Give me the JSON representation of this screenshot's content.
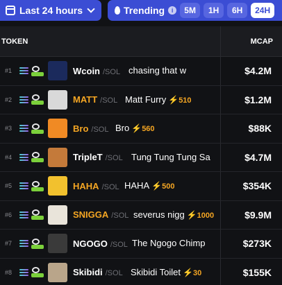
{
  "time_filter": {
    "label": "Last 24 hours"
  },
  "trending": {
    "label": "Trending",
    "info": "i",
    "timeframes": [
      "5M",
      "1H",
      "6H",
      "24H"
    ],
    "active": "24H"
  },
  "table": {
    "headers": {
      "token": "TOKEN",
      "mcap": "MCAP"
    },
    "rows": [
      {
        "rank": "#1",
        "name": "Wcoin",
        "pair": "/SOL",
        "desc": "chasing that w",
        "boost": "",
        "mcap": "$4.2M",
        "name_color": "#ffffff",
        "avatar_color": "#1b2a5c"
      },
      {
        "rank": "#2",
        "name": "MATT",
        "pair": "/SOL",
        "desc": "Matt Furry",
        "boost": "510",
        "mcap": "$1.2M",
        "name_color": "#f5a623",
        "avatar_color": "#d9d9d9"
      },
      {
        "rank": "#3",
        "name": "Bro",
        "pair": "/SOL",
        "desc": "Bro",
        "boost": "560",
        "mcap": "$88K",
        "name_color": "#f5a623",
        "avatar_color": "#f08a24"
      },
      {
        "rank": "#4",
        "name": "TripleT",
        "pair": "/SOL",
        "desc": "Tung Tung Tung Sa",
        "boost": "",
        "mcap": "$4.7M",
        "name_color": "#ffffff",
        "avatar_color": "#c47a3a"
      },
      {
        "rank": "#5",
        "name": "HAHA",
        "pair": "/SOL",
        "desc": "HAHA",
        "boost": "500",
        "mcap": "$354K",
        "name_color": "#f5a623",
        "avatar_color": "#f2c12e"
      },
      {
        "rank": "#6",
        "name": "SNIGGA",
        "pair": "/SOL",
        "desc": "severus nigg",
        "boost": "1000",
        "mcap": "$9.9M",
        "name_color": "#f5a623",
        "avatar_color": "#e9e4da"
      },
      {
        "rank": "#7",
        "name": "NGOGO",
        "pair": "/SOL",
        "desc": "The Ngogo Chimp",
        "boost": "",
        "mcap": "$273K",
        "name_color": "#ffffff",
        "avatar_color": "#3a3a3a"
      },
      {
        "rank": "#8",
        "name": "Skibidi",
        "pair": "/SOL",
        "desc": "Skibidi Toilet",
        "boost": "30",
        "mcap": "$155K",
        "name_color": "#ffffff",
        "avatar_color": "#b9a58a"
      }
    ]
  },
  "icons": {
    "calendar": "calendar-icon",
    "flame": "flame-icon",
    "chain": "solana-icon",
    "dex": "dex-icon"
  }
}
